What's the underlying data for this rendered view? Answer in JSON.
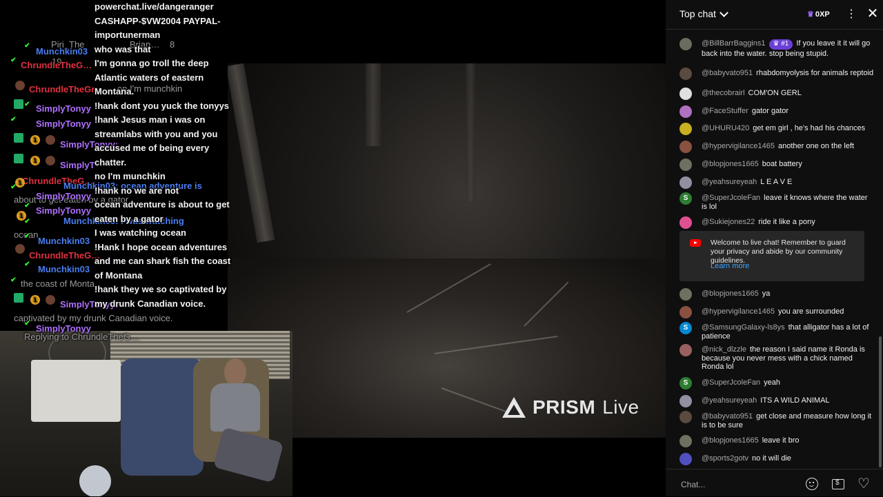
{
  "overlay_left": [
    {
      "t": "Piri_The",
      "c": "grey"
    },
    {
      "t": "Brian…",
      "c": "grey"
    },
    {
      "t": "8",
      "c": "grey"
    },
    {
      "t": "Munchkin03",
      "c": "blue"
    },
    {
      "t": "19",
      "c": "grey"
    },
    {
      "t": "ChrundleTheG…",
      "c": "red"
    },
    {
      "t": "on I'm munchkin",
      "c": "grey"
    },
    {
      "t": "ChrundleTheGr",
      "c": "red"
    },
    {
      "t": "SimplyTonyy",
      "c": "purple"
    },
    {
      "t": "SimplyTonyy",
      "c": "purple"
    },
    {
      "t": "SimplyTonyy:",
      "c": "purple"
    },
    {
      "t": "SimplyT",
      "c": "purple"
    },
    {
      "t": "ChrundleTheG…",
      "c": "red"
    },
    {
      "t": "Munchkin03: ocean adventure is",
      "c": "blue"
    },
    {
      "t": "about to get eaten by a gator",
      "c": "grey"
    },
    {
      "t": "SimplyTonyy",
      "c": "purple"
    },
    {
      "t": "SimplyTonyy",
      "c": "purple"
    },
    {
      "t": "Munchkin03: I was watching",
      "c": "blue"
    },
    {
      "t": "ocean",
      "c": "grey"
    },
    {
      "t": "Munchkin03",
      "c": "blue"
    },
    {
      "t": "ChrundleTheG…",
      "c": "red"
    },
    {
      "t": "Munchkin03",
      "c": "blue"
    },
    {
      "t": "the coast of Monta",
      "c": "grey"
    },
    {
      "t": "SimplyTonyy:",
      "c": "purple"
    },
    {
      "t": "captivated by my drunk Canadian voice.",
      "c": "grey"
    },
    {
      "t": "SimplyTonyy",
      "c": "purple"
    },
    {
      "t": "Replying to ChrundleTheG…",
      "c": "grey"
    }
  ],
  "overlay_right": [
    "powerchat.live/dangeranger",
    "CASHAPP-$VW2004 PAYPAL-importunerman",
    "who was that",
    "I'm gonna go troll the deep Atlantic waters of eastern Montana.",
    "!hank dont you yuck the tonyys",
    "!hank Jesus man i was on streamlabs with you and you accused me of being every chatter.",
    "no I'm munchkin",
    "!hank no we are not",
    "ocean adventure is about to get eaten by a gator",
    "I was watching ocean",
    "!Hank I hope ocean adventures and me can shark fish the coast of Montana",
    "!hank they we so captivated by my drunk Canadian voice."
  ],
  "watermark": {
    "brand": "PRISM",
    "suffix": "Live"
  },
  "chat": {
    "header": {
      "mode": "Top chat",
      "xp": "0XP",
      "more_icon": "more-vert-icon",
      "close_icon": "close-icon"
    },
    "messages": [
      {
        "user": "@BillBarrBaggins1",
        "rank": "#1",
        "text": "If you leave it it will go back into the water. stop being stupid.",
        "color": "#6b6b60"
      },
      {
        "user": "@babyvato951",
        "text": "rhabdomyolysis for animals reptoid",
        "color": "#5a4a40"
      },
      {
        "user": "@thecobrairl",
        "text": "COM'ON GERL",
        "color": "#e0e0e0"
      },
      {
        "user": "@FaceStuffer",
        "text": "gator gator",
        "color": "#b070c0"
      },
      {
        "user": "@UHURU420",
        "text": "get em girl , he's had his chances",
        "color": "#c8b020"
      },
      {
        "user": "@hypervigilance1465",
        "text": "another one on the left",
        "color": "#8a5040"
      },
      {
        "user": "@blopjones1665",
        "text": "boat battery",
        "color": "#707060"
      },
      {
        "user": "@yeahsureyeah",
        "text": "L E A V E",
        "color": "#9090a0"
      },
      {
        "user": "@SuperJcoleFan",
        "text": "leave it knows where the water is lol",
        "color": "#2e7d32",
        "initial": "S"
      },
      {
        "user": "@Sukiejones22",
        "text": "ride it like a pony",
        "color": "#e05090"
      },
      {
        "user": "@blopjones1665",
        "text": "ya",
        "color": "#707060"
      },
      {
        "user": "@hypervigilance1465",
        "text": "you are surrounded",
        "color": "#8a5040"
      },
      {
        "user": "@SamsungGalaxy-ls8ys",
        "text": "that alligator has a lot of patience",
        "color": "#0288d1",
        "initial": "S"
      },
      {
        "user": "@nick_dlzzle",
        "text": "the reason I said name it Ronda is because you never mess with a chick named Ronda lol",
        "color": "#9a6060"
      },
      {
        "user": "@SuperJcoleFan",
        "text": "yeah",
        "color": "#2e7d32",
        "initial": "S"
      },
      {
        "user": "@yeahsureyeah",
        "text": "ITS A WILD ANIMAL",
        "color": "#9090a0"
      },
      {
        "user": "@babyvato951",
        "text": "get close and measure how long it is to be sure",
        "color": "#5a4a40"
      },
      {
        "user": "@blopjones1665",
        "text": "leave it bro",
        "color": "#707060"
      },
      {
        "user": "@sports2gotv",
        "text": "no it will die",
        "color": "#5050c0"
      }
    ],
    "welcome": {
      "text": "Welcome to live chat! Remember to guard your privacy and abide by our community guidelines.",
      "link": "Learn more"
    },
    "input": {
      "placeholder": "Chat..."
    }
  }
}
